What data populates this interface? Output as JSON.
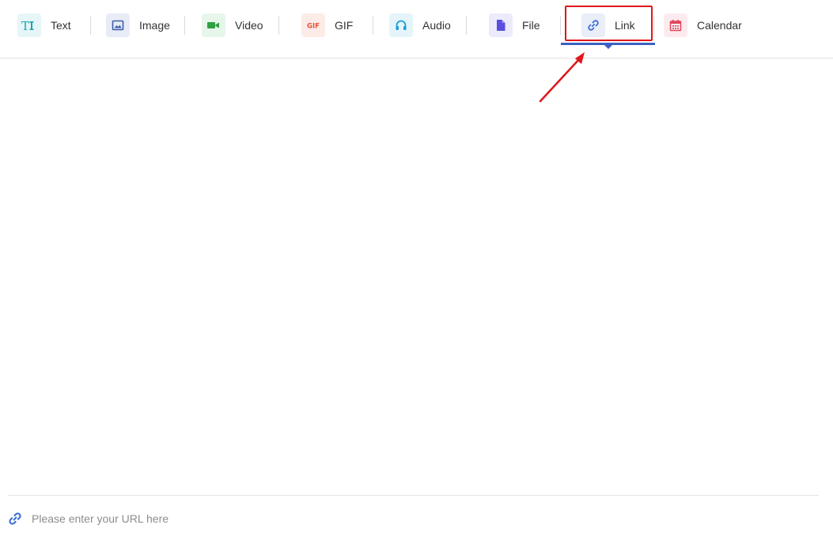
{
  "toolbar": {
    "tabs": [
      {
        "key": "text",
        "label": "Text",
        "icon": "text-format-icon",
        "color": "#1aa3b3",
        "bg": "#e6f6f8"
      },
      {
        "key": "image",
        "label": "Image",
        "icon": "image-icon",
        "color": "#3d5fa8",
        "bg": "#e8ecf7"
      },
      {
        "key": "video",
        "label": "Video",
        "icon": "video-camera-icon",
        "color": "#2ea043",
        "bg": "#e7f6ea"
      },
      {
        "key": "gif",
        "label": "GIF",
        "icon": "gif-icon",
        "icon_text": "GIF",
        "color": "#e3543b",
        "bg": "#fbece8"
      },
      {
        "key": "audio",
        "label": "Audio",
        "icon": "headphones-icon",
        "color": "#1a9fd6",
        "bg": "#e5f4fb"
      },
      {
        "key": "file",
        "label": "File",
        "icon": "file-icon",
        "color": "#5b4fe0",
        "bg": "#ecebfc"
      },
      {
        "key": "link",
        "label": "Link",
        "icon": "link-icon",
        "color": "#3d6fd6",
        "bg": "#e9eef9",
        "active": true
      },
      {
        "key": "calendar",
        "label": "Calendar",
        "icon": "calendar-icon",
        "color": "#e0465a",
        "bg": "#fcebee"
      }
    ],
    "active_color": "#3b62c4"
  },
  "annotation": {
    "highlight_color": "#e0161b"
  },
  "url_input": {
    "placeholder": "Please enter your URL here",
    "value": "",
    "icon": "link-icon"
  }
}
